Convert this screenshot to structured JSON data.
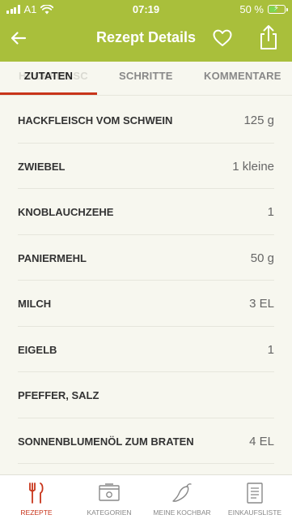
{
  "status_bar": {
    "carrier": "A1",
    "time": "07:19",
    "battery_percent": "50 %",
    "battery_level": 0.5
  },
  "header": {
    "title": "Rezept Details"
  },
  "tabs": [
    {
      "label": "ZUTATEN",
      "active": true
    },
    {
      "label": "SCHRITTE",
      "active": false
    },
    {
      "label": "KOMMENTARE",
      "active": false
    }
  ],
  "tab_ghost_text": "HACKFLEISC",
  "ingredients": [
    {
      "name": "HACKFLEISCH VOM SCHWEIN",
      "amount": "125 g"
    },
    {
      "name": "ZWIEBEL",
      "amount": "1 kleine"
    },
    {
      "name": "KNOBLAUCHZEHE",
      "amount": "1"
    },
    {
      "name": "PANIERMEHL",
      "amount": "50 g"
    },
    {
      "name": "MILCH",
      "amount": "3 EL"
    },
    {
      "name": "EIGELB",
      "amount": "1"
    },
    {
      "name": "PFEFFER, SALZ",
      "amount": ""
    },
    {
      "name": "SONNENBLUMENÖL ZUM BRATEN",
      "amount": "4 EL"
    }
  ],
  "bottom_nav": [
    {
      "label": "REZEPTE",
      "icon": "fork-knife-icon",
      "active": true
    },
    {
      "label": "KATEGORIEN",
      "icon": "tray-icon",
      "active": false
    },
    {
      "label": "MEINE KOCHBAR",
      "icon": "chili-icon",
      "active": false
    },
    {
      "label": "EINKAUFSLISTE",
      "icon": "list-icon",
      "active": false
    }
  ],
  "colors": {
    "header_green": "#a9bf3b",
    "accent_red": "#c8341a",
    "background": "#f7f7ef"
  }
}
